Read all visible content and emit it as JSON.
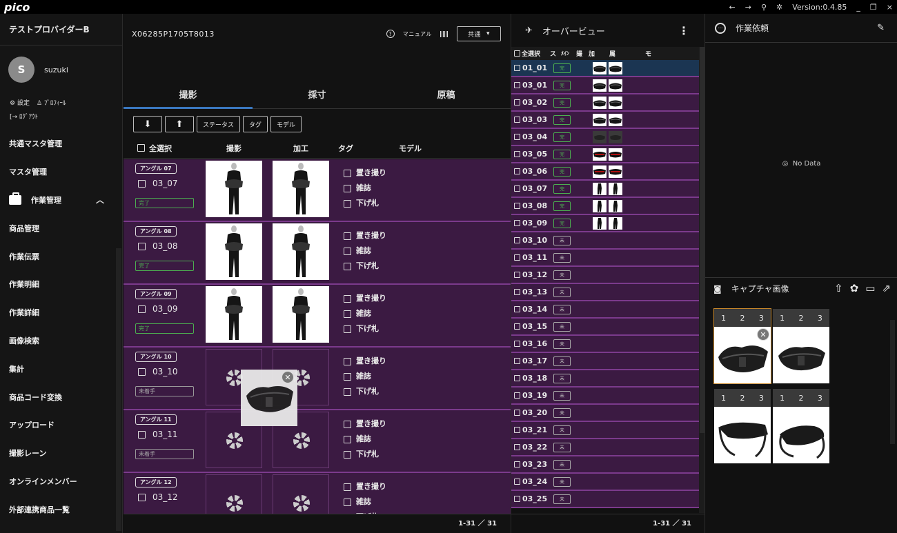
{
  "app": {
    "logo": "pico",
    "version": "Version:0.4.85",
    "nav": [
      "←",
      "→",
      "⚲",
      "✲"
    ],
    "window": [
      "_",
      "❐",
      "×"
    ]
  },
  "sidebar": {
    "provider": "テストプロバイダーB",
    "user": {
      "initial": "S",
      "name": "suzuki"
    },
    "links": {
      "settings": "設定",
      "profile": "ﾌﾟﾛﾌｨｰﾙ",
      "logout": "ﾛｸﾞｱｳﾄ"
    },
    "items": [
      {
        "label": "共通マスタ管理"
      },
      {
        "label": "マスタ管理"
      },
      {
        "label": "作業管理",
        "group": true
      },
      {
        "label": "商品管理"
      },
      {
        "label": "作業伝票"
      },
      {
        "label": "作業明細"
      },
      {
        "label": "作業詳細"
      },
      {
        "label": "画像検索"
      },
      {
        "label": "集計"
      },
      {
        "label": "商品コード変換"
      },
      {
        "label": "アップロード"
      },
      {
        "label": "撮影レーン"
      },
      {
        "label": "オンラインメンバー"
      },
      {
        "label": "外部連携商品一覧"
      }
    ]
  },
  "center": {
    "product_code": "X06285P1705T8013",
    "manual": "マニュアル",
    "select_value": "共通",
    "tabs": [
      "撮影",
      "採寸",
      "原稿"
    ],
    "toolbar": {
      "download": "⬇",
      "upload": "⬆",
      "status": "ステータス",
      "tag": "タグ",
      "model": "モデル"
    },
    "columns": {
      "select_all": "全選択",
      "shoot": "撮影",
      "process": "加工",
      "tag": "タグ",
      "model": "モデル"
    },
    "tag_labels": [
      "置き撮り",
      "雑誌",
      "下げ札"
    ],
    "rows": [
      {
        "angle": "アングル 07",
        "code": "03_07",
        "status": "完了",
        "done": true
      },
      {
        "angle": "アングル 08",
        "code": "03_08",
        "status": "完了",
        "done": true
      },
      {
        "angle": "アングル 09",
        "code": "03_09",
        "status": "完了",
        "done": true
      },
      {
        "angle": "アングル 10",
        "code": "03_10",
        "status": "未着手",
        "done": false
      },
      {
        "angle": "アングル 11",
        "code": "03_11",
        "status": "未着手",
        "done": false
      },
      {
        "angle": "アングル 12",
        "code": "03_12",
        "status": "",
        "done": false
      }
    ],
    "footer": "1-31 ／ 31"
  },
  "overview": {
    "title": "オーバービュー",
    "columns": [
      "全選択",
      "ス",
      "ﾒｲﾝ",
      "撮",
      "加",
      "属",
      "モ"
    ],
    "rows": [
      {
        "code": "01_01",
        "status": "完",
        "done": true,
        "img": "bag"
      },
      {
        "code": "03_01",
        "status": "完",
        "done": true,
        "img": "bag"
      },
      {
        "code": "03_02",
        "status": "完",
        "done": true,
        "img": "bag"
      },
      {
        "code": "03_03",
        "status": "完",
        "done": true,
        "img": "bag"
      },
      {
        "code": "03_04",
        "status": "完",
        "done": true,
        "img": "dark"
      },
      {
        "code": "03_05",
        "status": "完",
        "done": true,
        "img": "red"
      },
      {
        "code": "03_06",
        "status": "完",
        "done": true,
        "img": "red"
      },
      {
        "code": "03_07",
        "status": "完",
        "done": true,
        "img": "person"
      },
      {
        "code": "03_08",
        "status": "完",
        "done": true,
        "img": "person"
      },
      {
        "code": "03_09",
        "status": "完",
        "done": true,
        "img": "person"
      },
      {
        "code": "03_10",
        "status": "未",
        "done": false
      },
      {
        "code": "03_11",
        "status": "未",
        "done": false
      },
      {
        "code": "03_12",
        "status": "未",
        "done": false
      },
      {
        "code": "03_13",
        "status": "未",
        "done": false
      },
      {
        "code": "03_14",
        "status": "未",
        "done": false
      },
      {
        "code": "03_15",
        "status": "未",
        "done": false
      },
      {
        "code": "03_16",
        "status": "未",
        "done": false
      },
      {
        "code": "03_17",
        "status": "未",
        "done": false
      },
      {
        "code": "03_18",
        "status": "未",
        "done": false
      },
      {
        "code": "03_19",
        "status": "未",
        "done": false
      },
      {
        "code": "03_20",
        "status": "未",
        "done": false
      },
      {
        "code": "03_21",
        "status": "未",
        "done": false
      },
      {
        "code": "03_22",
        "status": "未",
        "done": false
      },
      {
        "code": "03_23",
        "status": "未",
        "done": false
      },
      {
        "code": "03_24",
        "status": "未",
        "done": false
      },
      {
        "code": "03_25",
        "status": "未",
        "done": false
      }
    ],
    "footer": "1-31 ／ 31"
  },
  "right": {
    "work_request": "作業依頼",
    "no_data": "No Data",
    "capture_title": "キャプチャ画像",
    "capture_nums": [
      "1",
      "2",
      "3"
    ]
  },
  "colors": {
    "row_bg": "#3b1a42",
    "row_border": "#7b3a8c",
    "status_done": "#4caf50",
    "tab_accent": "#3a78c0"
  }
}
